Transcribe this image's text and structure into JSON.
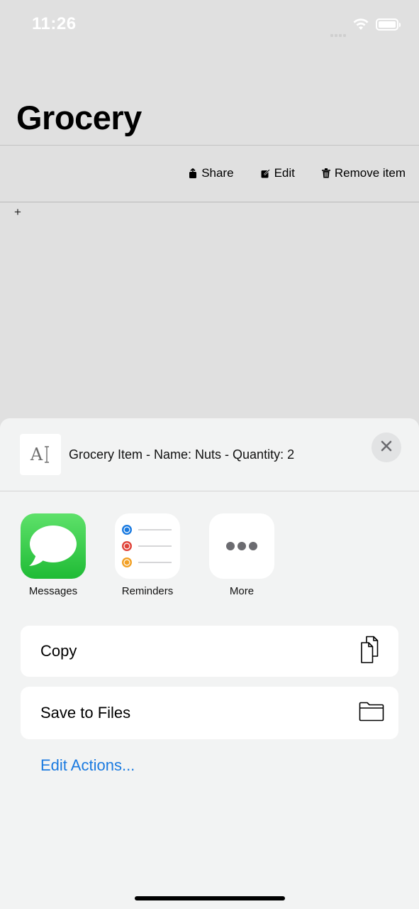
{
  "status_bar": {
    "time": "11:26"
  },
  "header": {
    "title": "Grocery"
  },
  "toolbar": {
    "share_label": "Share",
    "edit_label": "Edit",
    "remove_label": "Remove item"
  },
  "list": {
    "add_symbol": "+"
  },
  "share_sheet": {
    "preview_icon_text": "A",
    "preview_text": "Grocery Item - Name: Nuts - Quantity: 2",
    "apps": [
      {
        "label": "Messages",
        "icon": "messages-icon"
      },
      {
        "label": "Reminders",
        "icon": "reminders-icon"
      },
      {
        "label": "More",
        "icon": "more-icon"
      }
    ],
    "actions": [
      {
        "label": "Copy",
        "icon": "copy-icon"
      },
      {
        "label": "Save to Files",
        "icon": "folder-icon"
      }
    ],
    "edit_actions_label": "Edit Actions...",
    "colors": {
      "link": "#1a7ae0",
      "messages_green": "#2fc53f",
      "reminder_blue": "#1a7ae0",
      "reminder_red": "#e0443a",
      "reminder_orange": "#f2a024"
    }
  }
}
